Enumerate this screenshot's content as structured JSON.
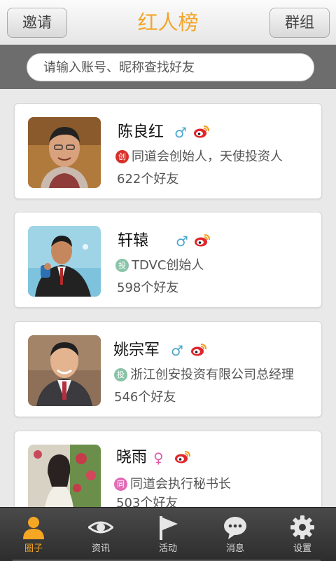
{
  "header": {
    "left_button": "邀请",
    "title": "红人榜",
    "right_button": "群组"
  },
  "search": {
    "placeholder": "请输入账号、昵称查找好友"
  },
  "users": [
    {
      "name": "陈良红",
      "gender": "male",
      "gender_symbol": "♂",
      "badge": "创",
      "badge_color": "#d8302a",
      "title": "同道会创始人，天使投资人",
      "friends": "622个好友"
    },
    {
      "name": "轩辕",
      "gender": "male",
      "gender_symbol": "♂",
      "badge": "投",
      "badge_color": "#8ac4a8",
      "title": "TDVC创始人",
      "friends": "598个好友"
    },
    {
      "name": "姚宗军",
      "gender": "male",
      "gender_symbol": "♂",
      "badge": "投",
      "badge_color": "#8ac4a8",
      "title": "浙江创安投资有限公司总经理",
      "friends": "546个好友"
    },
    {
      "name": "晓雨",
      "gender": "female",
      "gender_symbol": "♀",
      "badge": "同",
      "badge_color": "#e26bb6",
      "title": "同道会执行秘书长",
      "friends": "503个好友"
    }
  ],
  "tabs": [
    {
      "label": "圈子",
      "icon": "person-icon",
      "active": true
    },
    {
      "label": "资讯",
      "icon": "eye-icon",
      "active": false
    },
    {
      "label": "活动",
      "icon": "flag-icon",
      "active": false
    },
    {
      "label": "消息",
      "icon": "chat-bubble-icon",
      "active": false
    },
    {
      "label": "设置",
      "icon": "gear-icon",
      "active": false
    }
  ],
  "colors": {
    "accent": "#f3a52a",
    "tab_active": "#f5a623",
    "male": "#4aa6cf",
    "female": "#e15aa7",
    "weibo_red": "#e0262c"
  }
}
